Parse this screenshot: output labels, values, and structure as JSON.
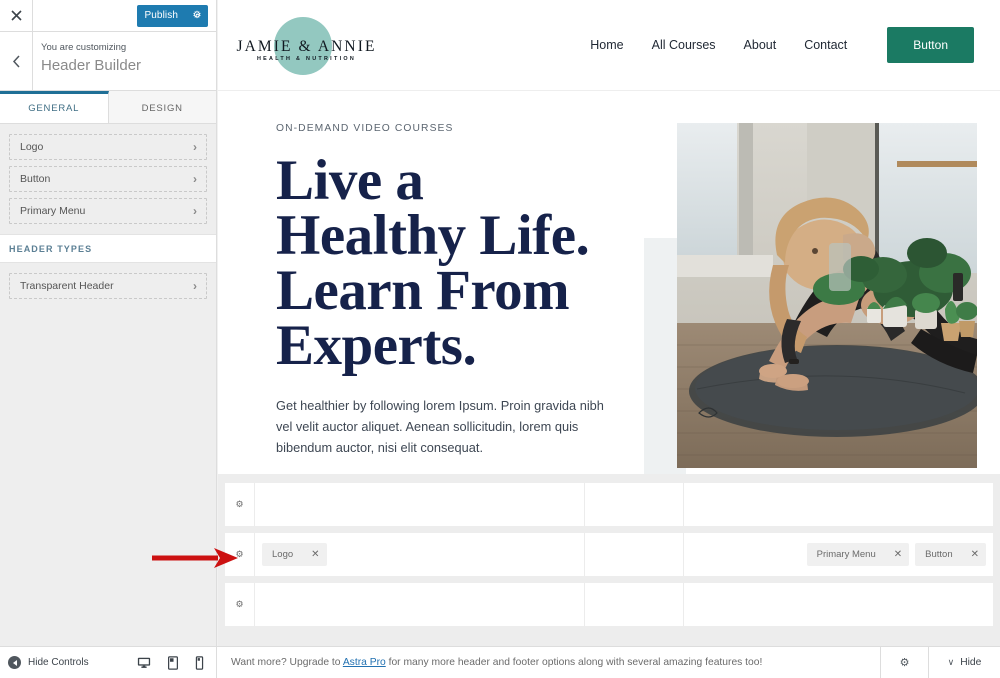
{
  "customizer": {
    "close_icon": "close-icon",
    "publish_label": "Publish",
    "publish_gear_icon": "gear-icon",
    "back_icon": "chevron-left-icon",
    "customizing_label": "You are customizing",
    "panel_title": "Header Builder",
    "tabs": [
      {
        "label": "GENERAL",
        "active": true
      },
      {
        "label": "DESIGN",
        "active": false
      }
    ],
    "items": [
      {
        "label": "Logo",
        "chevron": "›"
      },
      {
        "label": "Button",
        "chevron": "›"
      },
      {
        "label": "Primary Menu",
        "chevron": "›"
      }
    ],
    "section_header": "HEADER TYPES",
    "header_type_items": [
      {
        "label": "Transparent Header",
        "chevron": "›"
      }
    ]
  },
  "site": {
    "logo": {
      "name": "JAMIE & ANNIE",
      "tagline": "HEALTH & NUTRITION",
      "circle_color": "#93c8c0"
    },
    "nav": [
      {
        "label": "Home"
      },
      {
        "label": "All Courses"
      },
      {
        "label": "About"
      },
      {
        "label": "Contact"
      }
    ],
    "header_button": {
      "label": "Button",
      "color": "#1b7a63"
    },
    "hero": {
      "eyebrow": "ON-DEMAND VIDEO COURSES",
      "heading_line1": "Live a",
      "heading_line2": "Healthy Life.",
      "heading_line3": "Learn From",
      "heading_line4": "Experts.",
      "paragraph": "Get healthier by following lorem Ipsum. Proin gravida nibh vel velit auctor aliquet. Aenean sollicitudin, lorem quis bibendum auctor, nisi elit consequat.",
      "heading_color": "#16224a",
      "cta_color": "#1b7a63",
      "image_alt": "woman-doing-yoga-pose-in-plant-filled-studio"
    }
  },
  "builder": {
    "rows": [
      {
        "name": "above-header-row",
        "gear_icon": "gear-icon",
        "left_items": [],
        "center_items": [],
        "right_items": []
      },
      {
        "name": "primary-header-row",
        "gear_icon": "gear-icon",
        "left_items": [
          {
            "label": "Logo",
            "remove_icon": "close-icon"
          }
        ],
        "center_items": [],
        "right_items": [
          {
            "label": "Primary Menu",
            "remove_icon": "close-icon"
          },
          {
            "label": "Button",
            "remove_icon": "close-icon"
          }
        ]
      },
      {
        "name": "below-header-row",
        "gear_icon": "gear-icon",
        "left_items": [],
        "center_items": [],
        "right_items": []
      }
    ]
  },
  "bottombar": {
    "hide_controls_label": "Hide Controls",
    "devices": [
      {
        "name": "desktop-icon",
        "active": true
      },
      {
        "name": "tablet-icon",
        "active": false
      },
      {
        "name": "mobile-icon",
        "active": false
      }
    ],
    "note_prefix": "Want more? Upgrade to ",
    "note_link": "Astra Pro",
    "note_suffix": " for many more header and footer options along with several amazing features too!",
    "gear_icon": "gear-icon",
    "hide_label": "Hide",
    "hide_chevron": "∨"
  },
  "annotation": {
    "arrow_color": "#cc1111",
    "points_to": "primary-header-row-gear"
  }
}
